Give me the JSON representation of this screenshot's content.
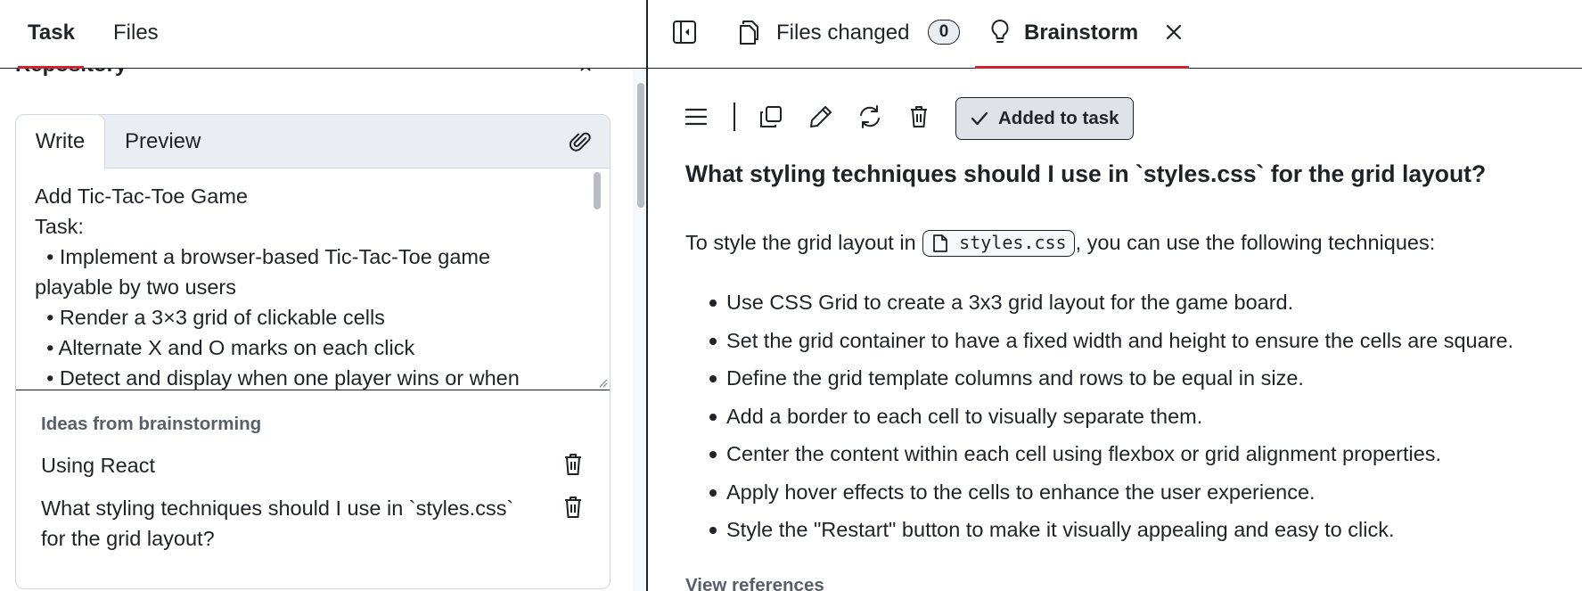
{
  "left_panel": {
    "tabs": [
      {
        "label": "Task",
        "active": true
      },
      {
        "label": "Files",
        "active": false
      }
    ],
    "section_heading": "Repository",
    "editor": {
      "tabs": [
        {
          "label": "Write",
          "active": true
        },
        {
          "label": "Preview",
          "active": false
        }
      ],
      "attach_icon": "paperclip-icon",
      "value": "Add Tic-Tac-Toe Game\nTask:\n  • Implement a browser-based Tic-Tac-Toe game playable by two users\n  • Render a 3×3 grid of clickable cells\n  • Alternate X and O marks on each click\n  • Detect and display when one player wins or when"
    },
    "ideas": {
      "title": "Ideas from brainstorming",
      "items": [
        {
          "text": "Using React",
          "delete_icon": "trash-icon"
        },
        {
          "text": "What styling techniques should I use in `styles.css` for the grid layout?",
          "delete_icon": "trash-icon"
        }
      ]
    }
  },
  "right_panel": {
    "tabs": {
      "sidebar_toggle_icon": "sidebar-toggle-icon",
      "files_changed": {
        "label": "Files changed",
        "count": "0",
        "icon": "file-diff-icon"
      },
      "brainstorm": {
        "label": "Brainstorm",
        "icon": "lightbulb-icon",
        "active": true
      },
      "close_icon": "close-icon"
    },
    "toolbar": {
      "icons": [
        "menu-icon",
        "copy-icon",
        "pencil-icon",
        "refresh-icon",
        "trash-icon"
      ],
      "added_button": {
        "label": "Added to task",
        "icon": "check-icon"
      }
    },
    "answer": {
      "question": "What styling techniques should I use in `styles.css` for the grid layout?",
      "intro_before": "To style the grid layout in ",
      "file_chip": "styles.css",
      "intro_after": ", you can use the following techniques:",
      "bullets": [
        "Use CSS Grid to create a 3x3 grid layout for the game board.",
        "Set the grid container to have a fixed width and height to ensure the cells are square.",
        "Define the grid template columns and rows to be equal in size.",
        "Add a border to each cell to visually separate them.",
        "Center the content within each cell using flexbox or grid alignment properties.",
        "Apply hover effects to the cells to enhance the user experience.",
        "Style the \"Restart\" button to make it visually appealing and easy to click."
      ],
      "view_references": "View references"
    }
  },
  "colors": {
    "tab_underline": "#cf222e",
    "text": "#1f2328",
    "muted_text": "#57606a",
    "border": "#d0d7de",
    "subtle_bg": "#eaeef2"
  }
}
